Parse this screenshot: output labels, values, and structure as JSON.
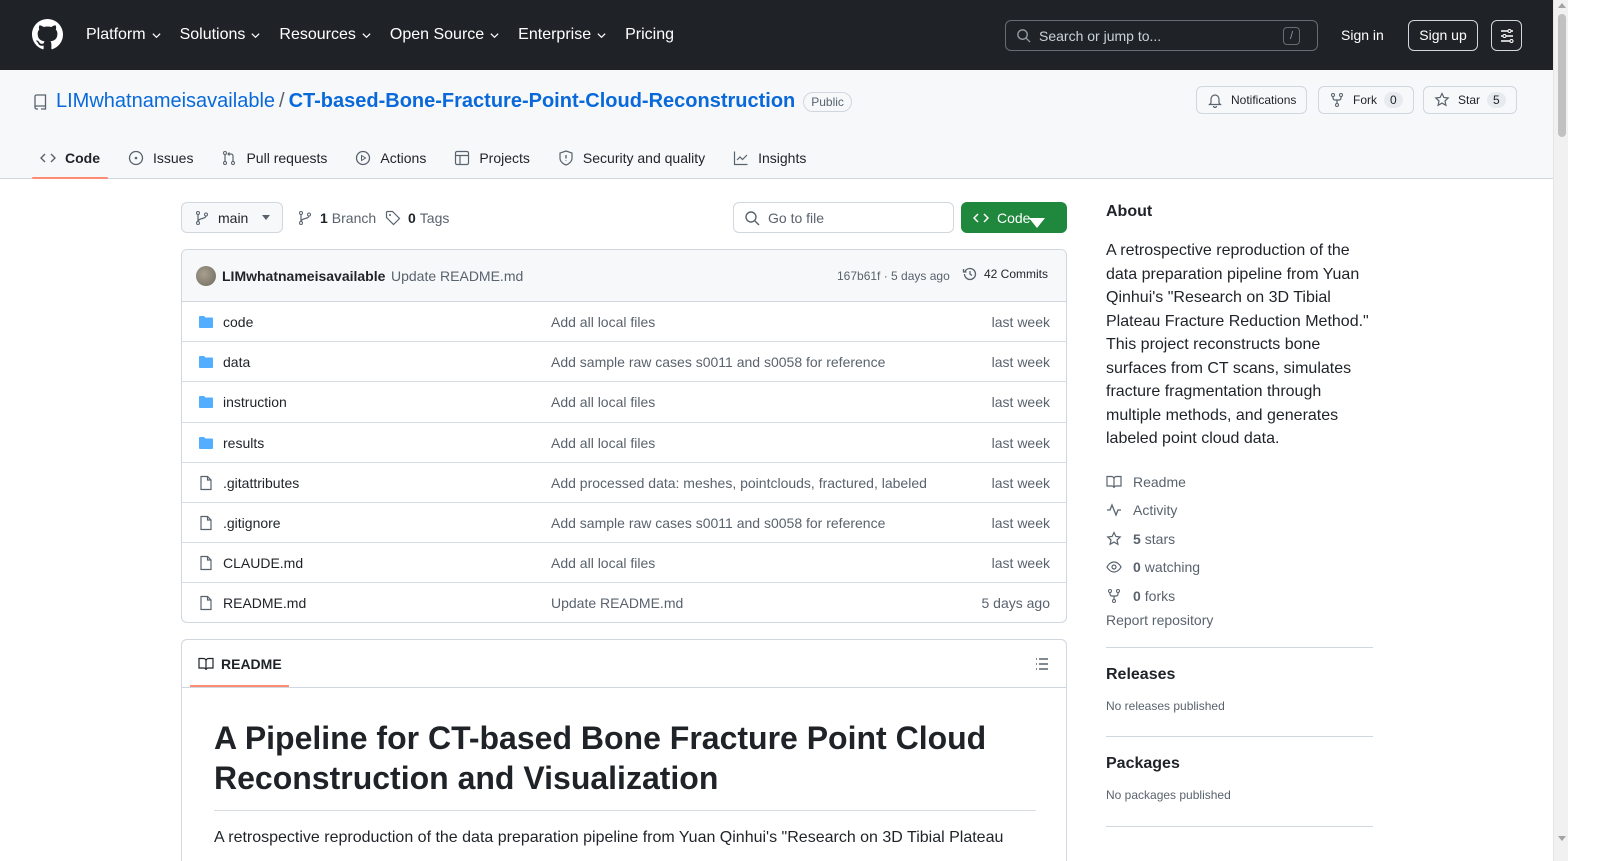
{
  "header": {
    "nav": [
      "Platform",
      "Solutions",
      "Resources",
      "Open Source",
      "Enterprise",
      "Pricing"
    ],
    "search_placeholder": "Search or jump to...",
    "search_shortcut": "/",
    "signin": "Sign in",
    "signup": "Sign up"
  },
  "repo": {
    "owner": "LIMwhatnameisavailable",
    "separator": "/",
    "name": "CT-based-Bone-Fracture-Point-Cloud-Reconstruction",
    "visibility": "Public",
    "notifications_label": "Notifications",
    "fork_label": "Fork",
    "fork_count": "0",
    "star_label": "Star",
    "star_count": "5"
  },
  "tabs": [
    "Code",
    "Issues",
    "Pull requests",
    "Actions",
    "Projects",
    "Security and quality",
    "Insights"
  ],
  "toolbar": {
    "branch": "main",
    "branch_count": "1",
    "branch_label": "Branch",
    "tag_count": "0",
    "tag_label": "Tags",
    "goto_file": "Go to file",
    "code_button": "Code"
  },
  "latest_commit": {
    "author": "LIMwhatnameisavailable",
    "message": "Update README.md",
    "sha_time": "167b61f · 5 days ago",
    "commits": "42 Commits"
  },
  "files": [
    {
      "name": "code",
      "type": "dir",
      "message": "Add all local files",
      "time": "last week"
    },
    {
      "name": "data",
      "type": "dir",
      "message": "Add sample raw cases s0011 and s0058 for reference",
      "time": "last week"
    },
    {
      "name": "instruction",
      "type": "dir",
      "message": "Add all local files",
      "time": "last week"
    },
    {
      "name": "results",
      "type": "dir",
      "message": "Add all local files",
      "time": "last week"
    },
    {
      "name": ".gitattributes",
      "type": "file",
      "message": "Add processed data: meshes, pointclouds, fractured, labeled",
      "time": "last week"
    },
    {
      "name": ".gitignore",
      "type": "file",
      "message": "Add sample raw cases s0011 and s0058 for reference",
      "time": "last week"
    },
    {
      "name": "CLAUDE.md",
      "type": "file",
      "message": "Add all local files",
      "time": "last week"
    },
    {
      "name": "README.md",
      "type": "file",
      "message": "Update README.md",
      "time": "5 days ago"
    }
  ],
  "readme": {
    "tab_label": "README",
    "title": "A Pipeline for CT-based Bone Fracture Point Cloud Reconstruction and Visualization",
    "intro": "A retrospective reproduction of the data preparation pipeline from Yuan Qinhui's \"Research on 3D Tibial Plateau"
  },
  "about": {
    "heading": "About",
    "description": "A retrospective reproduction of the data preparation pipeline from Yuan Qinhui's \"Research on 3D Tibial Plateau Fracture Reduction Method.\" This project reconstructs bone surfaces from CT scans, simulates fracture fragmentation through multiple methods, and generates labeled point cloud data.",
    "readme": "Readme",
    "activity": "Activity",
    "stars_count": "5",
    "stars_label": "stars",
    "watching_count": "0",
    "watching_label": "watching",
    "forks_count": "0",
    "forks_label": "forks",
    "report": "Report repository"
  },
  "releases": {
    "heading": "Releases",
    "text": "No releases published"
  },
  "packages": {
    "heading": "Packages",
    "text": "No packages published"
  },
  "colors": {
    "header_bg": "#1f2328",
    "link": "#0969da",
    "green": "#1f883d",
    "tab_accent": "#fd8c73",
    "folder": "#54aeff"
  }
}
